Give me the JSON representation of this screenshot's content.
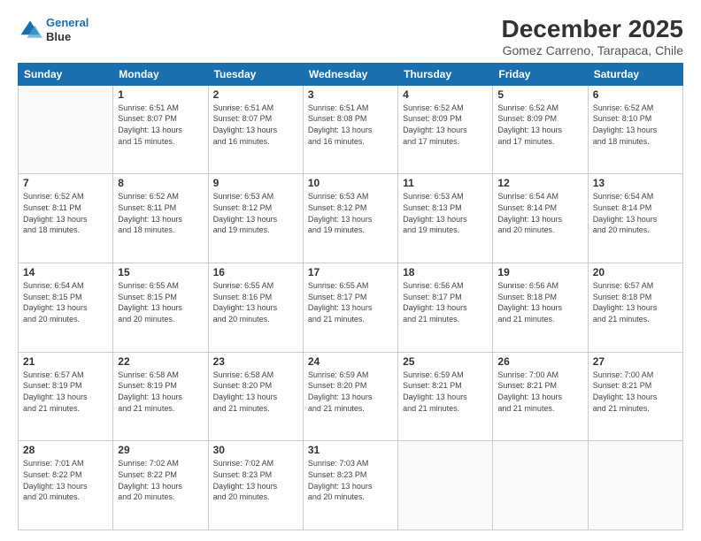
{
  "header": {
    "logo_line1": "General",
    "logo_line2": "Blue",
    "main_title": "December 2025",
    "sub_title": "Gomez Carreno, Tarapaca, Chile"
  },
  "weekdays": [
    "Sunday",
    "Monday",
    "Tuesday",
    "Wednesday",
    "Thursday",
    "Friday",
    "Saturday"
  ],
  "weeks": [
    [
      {
        "day": "",
        "info": ""
      },
      {
        "day": "1",
        "info": "Sunrise: 6:51 AM\nSunset: 8:07 PM\nDaylight: 13 hours\nand 15 minutes."
      },
      {
        "day": "2",
        "info": "Sunrise: 6:51 AM\nSunset: 8:07 PM\nDaylight: 13 hours\nand 16 minutes."
      },
      {
        "day": "3",
        "info": "Sunrise: 6:51 AM\nSunset: 8:08 PM\nDaylight: 13 hours\nand 16 minutes."
      },
      {
        "day": "4",
        "info": "Sunrise: 6:52 AM\nSunset: 8:09 PM\nDaylight: 13 hours\nand 17 minutes."
      },
      {
        "day": "5",
        "info": "Sunrise: 6:52 AM\nSunset: 8:09 PM\nDaylight: 13 hours\nand 17 minutes."
      },
      {
        "day": "6",
        "info": "Sunrise: 6:52 AM\nSunset: 8:10 PM\nDaylight: 13 hours\nand 18 minutes."
      }
    ],
    [
      {
        "day": "7",
        "info": "Sunrise: 6:52 AM\nSunset: 8:11 PM\nDaylight: 13 hours\nand 18 minutes."
      },
      {
        "day": "8",
        "info": "Sunrise: 6:52 AM\nSunset: 8:11 PM\nDaylight: 13 hours\nand 18 minutes."
      },
      {
        "day": "9",
        "info": "Sunrise: 6:53 AM\nSunset: 8:12 PM\nDaylight: 13 hours\nand 19 minutes."
      },
      {
        "day": "10",
        "info": "Sunrise: 6:53 AM\nSunset: 8:12 PM\nDaylight: 13 hours\nand 19 minutes."
      },
      {
        "day": "11",
        "info": "Sunrise: 6:53 AM\nSunset: 8:13 PM\nDaylight: 13 hours\nand 19 minutes."
      },
      {
        "day": "12",
        "info": "Sunrise: 6:54 AM\nSunset: 8:14 PM\nDaylight: 13 hours\nand 20 minutes."
      },
      {
        "day": "13",
        "info": "Sunrise: 6:54 AM\nSunset: 8:14 PM\nDaylight: 13 hours\nand 20 minutes."
      }
    ],
    [
      {
        "day": "14",
        "info": "Sunrise: 6:54 AM\nSunset: 8:15 PM\nDaylight: 13 hours\nand 20 minutes."
      },
      {
        "day": "15",
        "info": "Sunrise: 6:55 AM\nSunset: 8:15 PM\nDaylight: 13 hours\nand 20 minutes."
      },
      {
        "day": "16",
        "info": "Sunrise: 6:55 AM\nSunset: 8:16 PM\nDaylight: 13 hours\nand 20 minutes."
      },
      {
        "day": "17",
        "info": "Sunrise: 6:55 AM\nSunset: 8:17 PM\nDaylight: 13 hours\nand 21 minutes."
      },
      {
        "day": "18",
        "info": "Sunrise: 6:56 AM\nSunset: 8:17 PM\nDaylight: 13 hours\nand 21 minutes."
      },
      {
        "day": "19",
        "info": "Sunrise: 6:56 AM\nSunset: 8:18 PM\nDaylight: 13 hours\nand 21 minutes."
      },
      {
        "day": "20",
        "info": "Sunrise: 6:57 AM\nSunset: 8:18 PM\nDaylight: 13 hours\nand 21 minutes."
      }
    ],
    [
      {
        "day": "21",
        "info": "Sunrise: 6:57 AM\nSunset: 8:19 PM\nDaylight: 13 hours\nand 21 minutes."
      },
      {
        "day": "22",
        "info": "Sunrise: 6:58 AM\nSunset: 8:19 PM\nDaylight: 13 hours\nand 21 minutes."
      },
      {
        "day": "23",
        "info": "Sunrise: 6:58 AM\nSunset: 8:20 PM\nDaylight: 13 hours\nand 21 minutes."
      },
      {
        "day": "24",
        "info": "Sunrise: 6:59 AM\nSunset: 8:20 PM\nDaylight: 13 hours\nand 21 minutes."
      },
      {
        "day": "25",
        "info": "Sunrise: 6:59 AM\nSunset: 8:21 PM\nDaylight: 13 hours\nand 21 minutes."
      },
      {
        "day": "26",
        "info": "Sunrise: 7:00 AM\nSunset: 8:21 PM\nDaylight: 13 hours\nand 21 minutes."
      },
      {
        "day": "27",
        "info": "Sunrise: 7:00 AM\nSunset: 8:21 PM\nDaylight: 13 hours\nand 21 minutes."
      }
    ],
    [
      {
        "day": "28",
        "info": "Sunrise: 7:01 AM\nSunset: 8:22 PM\nDaylight: 13 hours\nand 20 minutes."
      },
      {
        "day": "29",
        "info": "Sunrise: 7:02 AM\nSunset: 8:22 PM\nDaylight: 13 hours\nand 20 minutes."
      },
      {
        "day": "30",
        "info": "Sunrise: 7:02 AM\nSunset: 8:23 PM\nDaylight: 13 hours\nand 20 minutes."
      },
      {
        "day": "31",
        "info": "Sunrise: 7:03 AM\nSunset: 8:23 PM\nDaylight: 13 hours\nand 20 minutes."
      },
      {
        "day": "",
        "info": ""
      },
      {
        "day": "",
        "info": ""
      },
      {
        "day": "",
        "info": ""
      }
    ]
  ]
}
